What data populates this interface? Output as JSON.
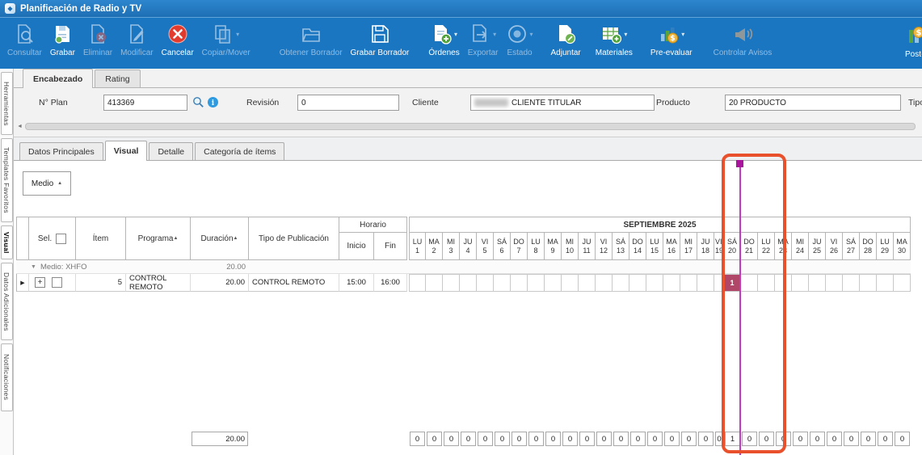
{
  "window": {
    "title": "Planificación de Radio y TV"
  },
  "toolbar": {
    "items": [
      {
        "label": "Consultar",
        "icon": "doc-search-icon",
        "enabled": false,
        "caret": false
      },
      {
        "label": "Grabar",
        "icon": "save-icon",
        "enabled": true,
        "caret": false
      },
      {
        "label": "Eliminar",
        "icon": "doc-delete-icon",
        "enabled": false,
        "caret": false
      },
      {
        "label": "Modificar",
        "icon": "doc-edit-icon",
        "enabled": false,
        "caret": false
      },
      {
        "label": "Cancelar",
        "icon": "cancel-icon",
        "enabled": true,
        "caret": false
      },
      {
        "label": "Copiar/Mover",
        "icon": "copy-move-icon",
        "enabled": false,
        "caret": true
      },
      {
        "label": "Obtener Borrador",
        "icon": "folder-open-icon",
        "enabled": false,
        "caret": false
      },
      {
        "label": "Grabar Borrador",
        "icon": "save-draft-icon",
        "enabled": true,
        "caret": false
      },
      {
        "label": "Órdenes",
        "icon": "orders-add-icon",
        "enabled": true,
        "caret": true
      },
      {
        "label": "Exportar",
        "icon": "export-icon",
        "enabled": false,
        "caret": true
      },
      {
        "label": "Estado",
        "icon": "status-icon",
        "enabled": false,
        "caret": true
      },
      {
        "label": "Adjuntar",
        "icon": "attach-icon",
        "enabled": true,
        "caret": false
      },
      {
        "label": "Materiales",
        "icon": "materials-icon",
        "enabled": true,
        "caret": true
      },
      {
        "label": "Pre-evaluar",
        "icon": "pre-evaluate-icon",
        "enabled": true,
        "caret": true
      },
      {
        "label": "Controlar Avisos",
        "icon": "announce-icon",
        "enabled": false,
        "caret": false
      },
      {
        "label": "Post-e",
        "icon": "post-evaluate-icon",
        "enabled": true,
        "caret": false
      }
    ]
  },
  "sidebar": {
    "items": [
      {
        "label": "Herramientas",
        "active": false
      },
      {
        "label": "Templates Favoritos",
        "active": false
      },
      {
        "label": "Visual",
        "active": true
      },
      {
        "label": "Datos Adicionales",
        "active": false
      },
      {
        "label": "Notificaciones",
        "active": false
      }
    ]
  },
  "header": {
    "tabs": [
      {
        "label": "Encabezado",
        "active": true
      },
      {
        "label": "Rating",
        "active": false
      }
    ],
    "fields": [
      {
        "label": "N° Plan",
        "value": "413369",
        "icons": [
          "magnifier-icon",
          "info-icon"
        ]
      },
      {
        "label": "Revisión",
        "value": "0"
      },
      {
        "label": "Cliente",
        "value": "CLIENTE TITULAR",
        "redacted_prefix": true
      },
      {
        "label": "Producto",
        "value": "20 PRODUCTO"
      },
      {
        "label": "Tipo",
        "value": ""
      }
    ]
  },
  "main": {
    "tabs": [
      {
        "label": "Datos Principales",
        "active": false
      },
      {
        "label": "Visual",
        "active": true
      },
      {
        "label": "Detalle",
        "active": false
      },
      {
        "label": "Categoría de ítems",
        "active": false
      }
    ],
    "group_button": {
      "label": "Medio"
    },
    "grid": {
      "horario_header": "Horario",
      "month_header": "SEPTIEMBRE 2025",
      "columns": [
        {
          "label": "Sel.",
          "checkbox": true
        },
        {
          "label": "Ítem"
        },
        {
          "label": "Programa",
          "sort": "asc"
        },
        {
          "label": "Duración",
          "sort": "asc"
        },
        {
          "label": "Tipo de Publicación"
        },
        {
          "label": "Inicio"
        },
        {
          "label": "Fin"
        }
      ],
      "days": [
        {
          "dow": "LU",
          "num": "1"
        },
        {
          "dow": "MA",
          "num": "2"
        },
        {
          "dow": "MI",
          "num": "3"
        },
        {
          "dow": "JU",
          "num": "4"
        },
        {
          "dow": "VI",
          "num": "5"
        },
        {
          "dow": "SÁ",
          "num": "6"
        },
        {
          "dow": "DO",
          "num": "7"
        },
        {
          "dow": "LU",
          "num": "8"
        },
        {
          "dow": "MA",
          "num": "9"
        },
        {
          "dow": "MI",
          "num": "10"
        },
        {
          "dow": "JU",
          "num": "11"
        },
        {
          "dow": "VI",
          "num": "12"
        },
        {
          "dow": "SÁ",
          "num": "13"
        },
        {
          "dow": "DO",
          "num": "14"
        },
        {
          "dow": "LU",
          "num": "15"
        },
        {
          "dow": "MA",
          "num": "16"
        },
        {
          "dow": "MI",
          "num": "17"
        },
        {
          "dow": "JU",
          "num": "18"
        },
        {
          "dow": "VI",
          "num": "19"
        },
        {
          "dow": "SÁ",
          "num": "20"
        },
        {
          "dow": "DO",
          "num": "21"
        },
        {
          "dow": "LU",
          "num": "22"
        },
        {
          "dow": "MA",
          "num": "23"
        },
        {
          "dow": "MI",
          "num": "24"
        },
        {
          "dow": "JU",
          "num": "25"
        },
        {
          "dow": "VI",
          "num": "26"
        },
        {
          "dow": "SÁ",
          "num": "27"
        },
        {
          "dow": "DO",
          "num": "28"
        },
        {
          "dow": "LU",
          "num": "29"
        },
        {
          "dow": "MA",
          "num": "30"
        }
      ],
      "group_row": {
        "label": "Medio: XHFO",
        "duracion": "20.00"
      },
      "rows": [
        {
          "item": "5",
          "programa": "CONTROL REMOTO",
          "duracion": "20.00",
          "tipo_publicacion": "CONTROL REMOTO",
          "inicio": "15:00",
          "fin": "16:00",
          "day_values": {
            "20": "1"
          }
        }
      ],
      "totals": {
        "duracion": "20.00",
        "day_values": [
          "0",
          "0",
          "0",
          "0",
          "0",
          "0",
          "0",
          "0",
          "0",
          "0",
          "0",
          "0",
          "0",
          "0",
          "0",
          "0",
          "0",
          "0",
          "0",
          "1",
          "0",
          "0",
          "0",
          "0",
          "0",
          "0",
          "0",
          "0",
          "0",
          "0"
        ]
      }
    }
  },
  "colors": {
    "toolbar_blue": "#1b76c2",
    "highlight_cell": "#b14768",
    "cursor_line": "#c23ac2",
    "cursor_marker": "#a8149c",
    "annotation": "#e8512c"
  }
}
